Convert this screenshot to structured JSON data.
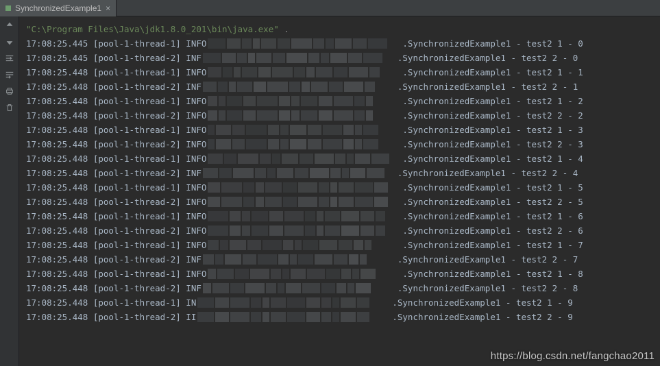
{
  "tab": {
    "title": "SynchronizedExample1",
    "close_glyph": "×"
  },
  "gutter": {
    "items": [
      {
        "name": "up-arrow-icon"
      },
      {
        "name": "down-arrow-icon"
      },
      {
        "name": "wrap-icon-1"
      },
      {
        "name": "wrap-icon-2"
      },
      {
        "name": "print-icon"
      },
      {
        "name": "trash-icon"
      }
    ]
  },
  "console": {
    "command_line": "\"C:\\Program Files\\Java\\jdk1.8.0_201\\bin\\java.exe\"",
    "log_class": ".SynchronizedExample1",
    "method": "test2",
    "lines": [
      {
        "ts": "17:08:25.445",
        "thread": "pool-1-thread-1",
        "level": "INFO",
        "instance": 1,
        "i": 0
      },
      {
        "ts": "17:08:25.445",
        "thread": "pool-1-thread-2",
        "level": "INF",
        "instance": 2,
        "i": 0
      },
      {
        "ts": "17:08:25.448",
        "thread": "pool-1-thread-1",
        "level": "INFO",
        "instance": 1,
        "i": 1
      },
      {
        "ts": "17:08:25.448",
        "thread": "pool-1-thread-2",
        "level": "INF",
        "instance": 2,
        "i": 1
      },
      {
        "ts": "17:08:25.448",
        "thread": "pool-1-thread-1",
        "level": "INFO",
        "instance": 1,
        "i": 2
      },
      {
        "ts": "17:08:25.448",
        "thread": "pool-1-thread-2",
        "level": "INFO",
        "instance": 2,
        "i": 2
      },
      {
        "ts": "17:08:25.448",
        "thread": "pool-1-thread-1",
        "level": "INFO",
        "instance": 1,
        "i": 3
      },
      {
        "ts": "17:08:25.448",
        "thread": "pool-1-thread-2",
        "level": "INFO",
        "instance": 2,
        "i": 3
      },
      {
        "ts": "17:08:25.448",
        "thread": "pool-1-thread-1",
        "level": "INFO",
        "instance": 1,
        "i": 4
      },
      {
        "ts": "17:08:25.448",
        "thread": "pool-1-thread-2",
        "level": "INF",
        "instance": 2,
        "i": 4
      },
      {
        "ts": "17:08:25.448",
        "thread": "pool-1-thread-1",
        "level": "INFO",
        "instance": 1,
        "i": 5
      },
      {
        "ts": "17:08:25.448",
        "thread": "pool-1-thread-2",
        "level": "INFO",
        "instance": 2,
        "i": 5
      },
      {
        "ts": "17:08:25.448",
        "thread": "pool-1-thread-1",
        "level": "INFO",
        "instance": 1,
        "i": 6
      },
      {
        "ts": "17:08:25.448",
        "thread": "pool-1-thread-2",
        "level": "INFO",
        "instance": 2,
        "i": 6
      },
      {
        "ts": "17:08:25.448",
        "thread": "pool-1-thread-1",
        "level": "INFO",
        "instance": 1,
        "i": 7
      },
      {
        "ts": "17:08:25.448",
        "thread": "pool-1-thread-2",
        "level": "INF",
        "instance": 2,
        "i": 7
      },
      {
        "ts": "17:08:25.448",
        "thread": "pool-1-thread-1",
        "level": "INFO",
        "instance": 1,
        "i": 8
      },
      {
        "ts": "17:08:25.448",
        "thread": "pool-1-thread-2",
        "level": "INF",
        "instance": 2,
        "i": 8
      },
      {
        "ts": "17:08:25.448",
        "thread": "pool-1-thread-1",
        "level": "IN",
        "instance": 1,
        "i": 9
      },
      {
        "ts": "17:08:25.448",
        "thread": "pool-1-thread-2",
        "level": "II",
        "instance": 2,
        "i": 9
      }
    ]
  },
  "watermark": "https://blog.csdn.net/fangchao2011"
}
